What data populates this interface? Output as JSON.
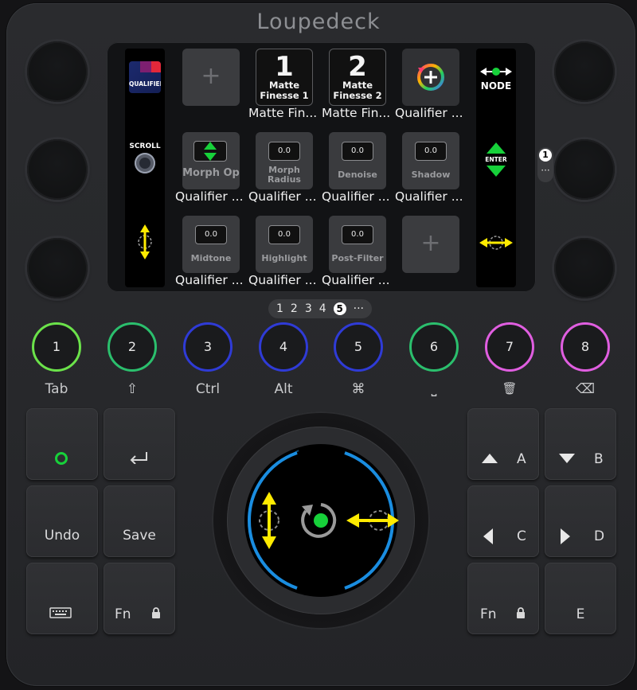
{
  "brand": {
    "logo": "Loupedeck"
  },
  "screen": {
    "left_strip": {
      "qualifier_label": "QUALIFIER",
      "scroll_label": "SCROLL"
    },
    "right_strip": {
      "node_label": "NODE",
      "enter_label": "ENTER"
    },
    "rows": [
      [
        {
          "kind": "empty",
          "label": ""
        },
        {
          "kind": "matte",
          "num": "1",
          "sub1": "Matte",
          "sub2": "Finesse 1",
          "label": "Matte Fin..."
        },
        {
          "kind": "matte",
          "num": "2",
          "sub1": "Matte",
          "sub2": "Finesse 2",
          "label": "Matte Fin..."
        },
        {
          "kind": "add-node",
          "label": "Qualifier ..."
        }
      ],
      [
        {
          "kind": "morph",
          "title": "Morph Op",
          "label": "Qualifier ..."
        },
        {
          "kind": "value",
          "value": "0.0",
          "title1": "Morph",
          "title2": "Radius",
          "label": "Qualifier ..."
        },
        {
          "kind": "value",
          "value": "0.0",
          "title1": "Denoise",
          "title2": "",
          "label": "Qualifier ..."
        },
        {
          "kind": "value",
          "value": "0.0",
          "title1": "Shadow",
          "title2": "",
          "label": "Qualifier ..."
        }
      ],
      [
        {
          "kind": "value",
          "value": "0.0",
          "title1": "Midtone",
          "title2": "",
          "label": "Qualifier ..."
        },
        {
          "kind": "value",
          "value": "0.0",
          "title1": "Highlight",
          "title2": "",
          "label": "Qualifier ..."
        },
        {
          "kind": "value",
          "value": "0.0",
          "title1": "Post-Filter",
          "title2": "",
          "label": "Qualifier ..."
        },
        {
          "kind": "empty",
          "label": ""
        }
      ]
    ],
    "plus_glyph": "+"
  },
  "pager": {
    "pages": [
      "1",
      "2",
      "3",
      "4"
    ],
    "active": "5",
    "more": "···"
  },
  "side_badge": {
    "number": "1",
    "more": "···"
  },
  "round_buttons": [
    {
      "num": "1",
      "label": "Tab",
      "color": "#6be24a"
    },
    {
      "num": "2",
      "label": "⇧",
      "color": "#2bbf6d"
    },
    {
      "num": "3",
      "label": "Ctrl",
      "color": "#2f3bd6"
    },
    {
      "num": "4",
      "label": "Alt",
      "color": "#2f3bd6"
    },
    {
      "num": "5",
      "label": "⌘",
      "color": "#2f3bd6"
    },
    {
      "num": "6",
      "label": "⎵",
      "color": "#2bbf6d"
    },
    {
      "num": "7",
      "label": "🗑",
      "color": "#e05ee0"
    },
    {
      "num": "8",
      "label": "⌫",
      "color": "#e05ee0"
    }
  ],
  "keys": {
    "undo": "Undo",
    "save": "Save",
    "fn_left": "Fn",
    "fn_right": "Fn",
    "a": "A",
    "b": "B",
    "c": "C",
    "d": "D",
    "e": "E"
  },
  "colors": {
    "accent_green": "#17d13a",
    "arrow_yellow": "#ffeb00",
    "dial_blue": "#1a8de0"
  }
}
